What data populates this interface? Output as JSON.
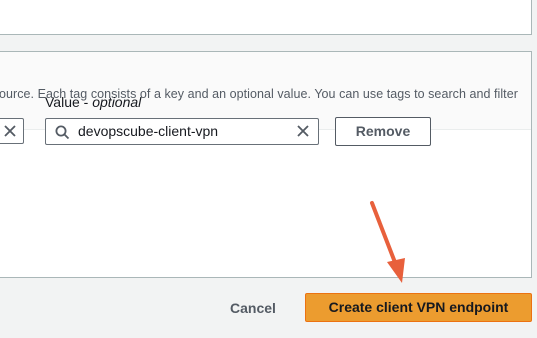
{
  "tags_section": {
    "description": "ource. Each tag consists of a key and an optional value. You can use tags to search and filter"
  },
  "tag_row": {
    "value_label": "Value",
    "value_optional": "optional",
    "value_input": "devopscube-client-vpn",
    "remove_label": "Remove"
  },
  "footer": {
    "cancel_label": "Cancel",
    "create_label": "Create client VPN endpoint"
  },
  "icons": {
    "search": "search-icon",
    "clear": "x-icon",
    "annotation": "arrow-annotation"
  },
  "colors": {
    "primary_button": "#ec9c2f",
    "annotation_arrow": "#e8603c"
  }
}
